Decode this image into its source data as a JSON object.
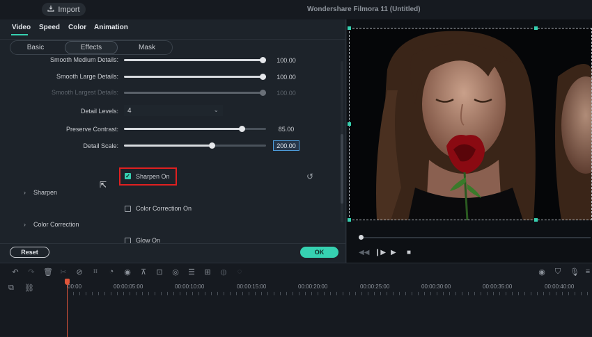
{
  "app": {
    "title": "Wondershare Filmora 11 (Untitled)",
    "import_label": "Import",
    "import_icon": "import-icon"
  },
  "tabs": [
    {
      "label": "Video",
      "active": true
    },
    {
      "label": "Speed",
      "active": false
    },
    {
      "label": "Color",
      "active": false
    },
    {
      "label": "Animation",
      "active": false
    }
  ],
  "subtabs": [
    {
      "label": "Basic",
      "active": false
    },
    {
      "label": "Effects",
      "active": true
    },
    {
      "label": "Mask",
      "active": false
    }
  ],
  "settings": {
    "rows": [
      {
        "label": "Smooth Medium Details:",
        "value": "100.00",
        "level": 1.0,
        "enabled": true
      },
      {
        "label": "Smooth Large Details:",
        "value": "100.00",
        "level": 1.0,
        "enabled": true
      },
      {
        "label": "Smooth Largest Details:",
        "value": "100.00",
        "level": 1.0,
        "enabled": false
      },
      {
        "label": "Preserve Contrast:",
        "value": "85.00",
        "level": 0.85,
        "enabled": true
      },
      {
        "label": "Detail Scale:",
        "value": "200.00",
        "level": 0.63,
        "enabled": true,
        "focused": true
      }
    ],
    "detail_levels": {
      "label": "Detail Levels:",
      "value": "4"
    }
  },
  "checkboxes": [
    {
      "label": "Sharpen On",
      "checked": true,
      "highlighted": true
    },
    {
      "label": "Color Correction On",
      "checked": false
    },
    {
      "label": "Glow On",
      "checked": false
    }
  ],
  "sections": [
    {
      "label": "Sharpen"
    },
    {
      "label": "Color Correction"
    }
  ],
  "buttons": {
    "reset": "Reset",
    "ok": "OK"
  },
  "timeline": {
    "times": [
      "00:00",
      "00:00:05:00",
      "00:00:10:00",
      "00:00:15:00",
      "00:00:20:00",
      "00:00:25:00",
      "00:00:30:00",
      "00:00:35:00",
      "00:00:40:00"
    ]
  },
  "colors": {
    "accent": "#36d1b1",
    "highlight_box": "#e02020",
    "playhead": "#e0553a"
  }
}
